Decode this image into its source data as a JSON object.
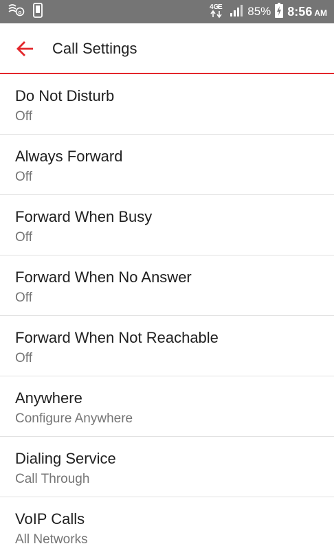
{
  "colors": {
    "accent": "#e3262b",
    "status_bar": "#757575",
    "title_text": "#1f1f1f",
    "subtitle_text": "#757575",
    "divider": "#e2e2e2"
  },
  "status_bar": {
    "icons_left": [
      "vvm-icon",
      "phone-device-icon"
    ],
    "network_label": "4G",
    "battery_percent": "85%",
    "time": "8:56",
    "ampm": "AM"
  },
  "header": {
    "back_icon": "arrow-left-icon",
    "title": "Call Settings"
  },
  "settings": [
    {
      "title": "Do Not Disturb",
      "value": "Off"
    },
    {
      "title": "Always Forward",
      "value": "Off"
    },
    {
      "title": "Forward When Busy",
      "value": "Off"
    },
    {
      "title": "Forward When No Answer",
      "value": "Off"
    },
    {
      "title": "Forward When Not Reachable",
      "value": "Off"
    },
    {
      "title": "Anywhere",
      "value": "Configure Anywhere"
    },
    {
      "title": "Dialing Service",
      "value": "Call Through"
    },
    {
      "title": "VoIP Calls",
      "value": "All Networks"
    }
  ]
}
